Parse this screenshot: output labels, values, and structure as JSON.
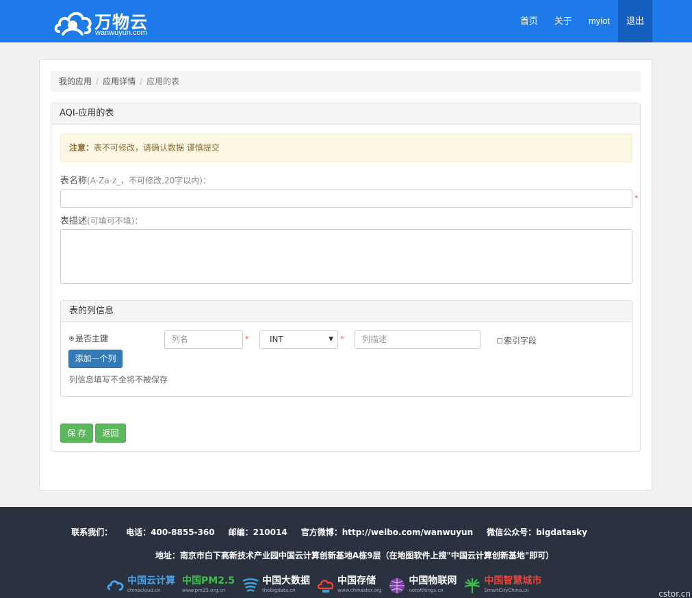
{
  "header": {
    "logo_text": "万物云",
    "logo_sub": "wanwuyun.com",
    "nav": [
      "首页",
      "关于",
      "myiot",
      "退出"
    ],
    "active_nav": "退出"
  },
  "breadcrumb": [
    "我的应用",
    "应用详情",
    "应用的表"
  ],
  "panel_title": "AQI-应用的表",
  "alert": {
    "strong": "注意：",
    "text": "表不可修改，请确认数据 谨慎提交"
  },
  "form": {
    "name_label": "表名称",
    "name_hint": "(A-Za-z_，不可修改,20字以内)：",
    "name_value": "",
    "required_mark": "*",
    "desc_label": "表描述",
    "desc_hint": "(可填可不填)：",
    "desc_value": ""
  },
  "columns": {
    "title": "表的列信息",
    "primary_key_label": "是否主键",
    "col_name_placeholder": "列名",
    "col_type_value": "INT",
    "col_desc_placeholder": "列描述",
    "index_label": "索引字段",
    "add_button": "添加一个列",
    "note": "列信息填写不全将不被保存"
  },
  "buttons": {
    "save": "保 存",
    "back": "返回"
  },
  "footer": {
    "contact_label": "联系我们：",
    "phone": "电话：400-8855-360",
    "zip": "邮编：210014",
    "weibo": "官方微博：http://weibo.com/wanwuyun",
    "wechat": "微信公众号：bigdatasky",
    "address": "地址：南京市白下高新技术产业园中国云计算创新基地A栋9层（在地图软件上搜\"中国云计算创新基地\"即可）",
    "partners": [
      {
        "name": "中国云计算",
        "url": "chinacloud.cn",
        "color": "#4aa3e8"
      },
      {
        "name": "中国PM2.5",
        "url": "www.pm25.org.cn",
        "color": "#3cc04a"
      },
      {
        "name": "中国大数据",
        "url": "thebigdata.cn",
        "color": "#ffffff"
      },
      {
        "name": "中国存储",
        "url": "www.chinastor.org",
        "color": "#ffffff"
      },
      {
        "name": "中国物联网",
        "url": "netofthings.cn",
        "color": "#ffffff"
      },
      {
        "name": "中国智慧城市",
        "url": "SmartCityChina.cn",
        "color": "#e8443a"
      }
    ],
    "watermark": "cstor.cn"
  }
}
